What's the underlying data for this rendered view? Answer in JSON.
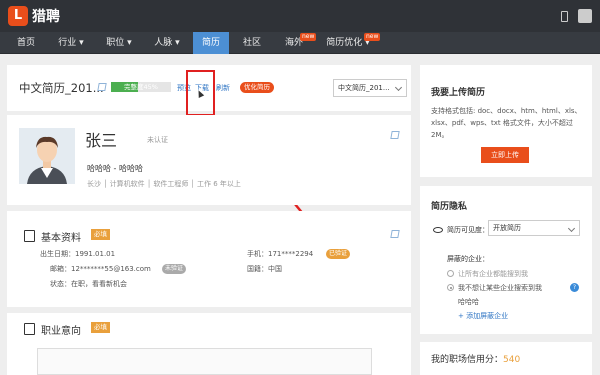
{
  "brand": {
    "logo_letter": "L",
    "name": "猎聘"
  },
  "nav": {
    "items": [
      {
        "label": "首页"
      },
      {
        "label": "行业 ▾"
      },
      {
        "label": "职位 ▾"
      },
      {
        "label": "人脉 ▾"
      },
      {
        "label": "简历"
      },
      {
        "label": "社区"
      },
      {
        "label": "海外"
      },
      {
        "label": "简历优化 ▾"
      }
    ],
    "badge_overseas": "new",
    "badge_optimize": "new"
  },
  "resume_header": {
    "title": "中文简历_201...",
    "progress_label": "完整度45%",
    "progress": 0.45,
    "link_preview": "预览",
    "link_download": "下载",
    "link_refresh": "刷新",
    "optimize_label": "优化简历",
    "select_value": "中文简历_201..."
  },
  "profile": {
    "name": "张三",
    "verify_status": "未认证",
    "tagline": "哈哈哈 - 哈哈哈",
    "meta": "长沙 │ 计算机软件 │ 软件工程师 │ 工作 6 年以上"
  },
  "basic_info": {
    "title": "基本资料",
    "required": "必填",
    "birth_label": "出生日期：",
    "birth_value": "1991.01.01",
    "email_label": "邮箱：",
    "email_value": "12*******55@163.com",
    "email_status": "未验证",
    "status_label": "状态：",
    "status_value": "在职，看看新机会",
    "phone_label": "手机：",
    "phone_value": "171****2294",
    "phone_status": "已验证",
    "country_label": "国籍：",
    "country_value": "中国"
  },
  "intent": {
    "title": "职业意向",
    "required": "必填"
  },
  "upload": {
    "title": "我要上传简历",
    "desc": "支持格式包括: doc、docx、htm、html、xls、xlsx、pdf、wps、txt 格式文件，大小不超过2M。",
    "button": "立即上传"
  },
  "privacy": {
    "title": "简历隐私",
    "visibility_label": "简历可见度：",
    "visibility_value": "开放简历",
    "blocked_label": "屏蔽的企业：",
    "option1": "让所有企业都能搜到我",
    "option2": "我不想让某些企业搜索到我",
    "company": "哈哈哈",
    "add_link": "+ 添加屏蔽企业"
  },
  "credit": {
    "label": "我的职场信用分：",
    "score": "540"
  },
  "colors": {
    "brand": "#e94e1b",
    "nav_active": "#4c8fd4",
    "link": "#2f75c4",
    "required": "#e9a03c"
  }
}
